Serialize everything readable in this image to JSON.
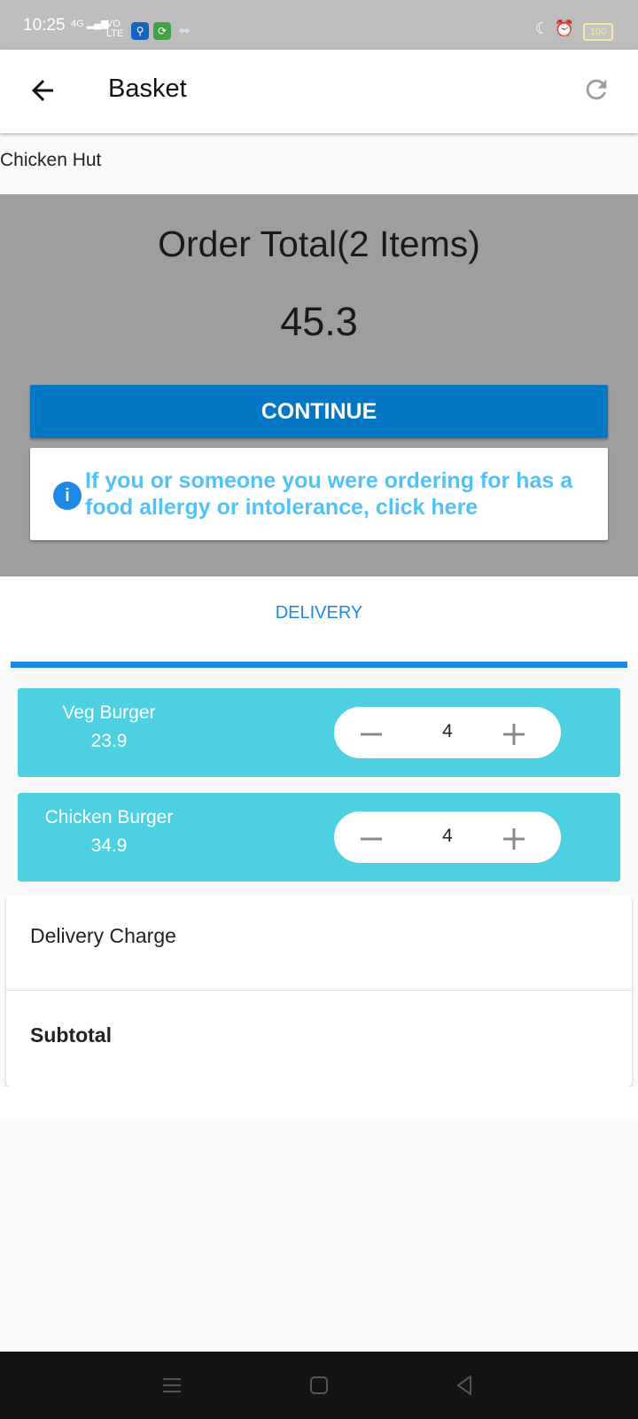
{
  "status_bar": {
    "time": "10:25",
    "network": "4G",
    "volte": "VO LTE",
    "battery": "100"
  },
  "app_bar": {
    "title": "Basket",
    "back_icon": "arrow-back-icon",
    "refresh_icon": "refresh-icon"
  },
  "restaurant": {
    "name": "Chicken Hut"
  },
  "summary_panel": {
    "order_total_label": "Order Total(2 Items)",
    "order_total_value": "45.3",
    "continue_label": "CONTINUE",
    "allergy_text": "If you or someone you were ordering for has a food allergy or intolerance, click here"
  },
  "tabs": {
    "delivery": "DELIVERY"
  },
  "items": [
    {
      "name": "Veg Burger",
      "price": "23.9",
      "quantity": "4"
    },
    {
      "name": "Chicken Burger",
      "price": "34.9",
      "quantity": "4"
    }
  ],
  "charges": {
    "delivery_charge_label": "Delivery Charge",
    "subtotal_label": "Subtotal"
  },
  "colors": {
    "primary": "#0277c4",
    "accent": "#1e88e5",
    "item_card": "#4dd0e1",
    "allergy_text": "#4fc3f7",
    "panel": "#9e9e9e"
  }
}
